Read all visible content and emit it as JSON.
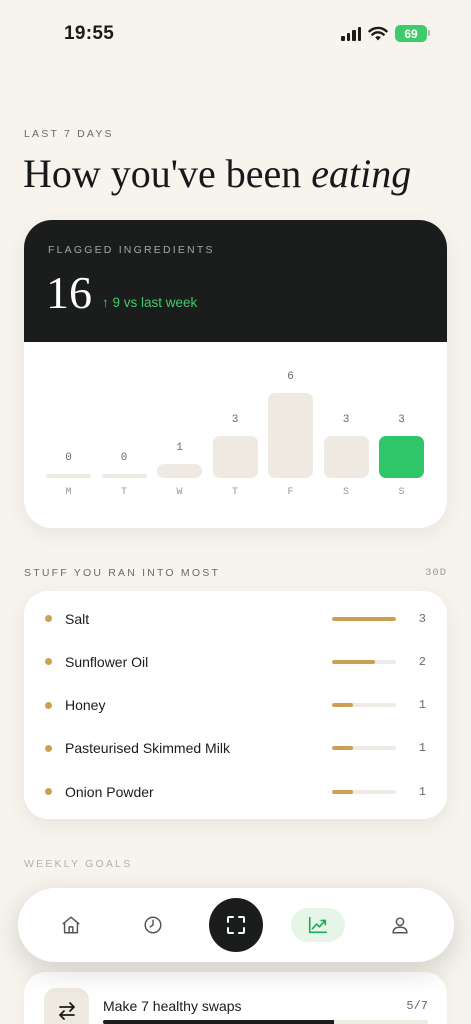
{
  "status": {
    "time": "19:55",
    "battery": "69"
  },
  "header": {
    "eyebrow": "LAST 7 DAYS",
    "title_main": "How you've been",
    "title_em": "eating"
  },
  "flagged": {
    "label": "FLAGGED INGREDIENTS",
    "count": "16",
    "delta": "↑ 9 vs last week",
    "accent": "#2fc66a"
  },
  "chart_data": {
    "type": "bar",
    "categories": [
      "M",
      "T",
      "W",
      "T",
      "F",
      "S",
      "S"
    ],
    "values": [
      0,
      0,
      1,
      3,
      6,
      3,
      3
    ],
    "highlight_index": 6,
    "ylim": [
      0,
      6
    ]
  },
  "stuff": {
    "label": "STUFF YOU RAN INTO MOST",
    "range": "30D",
    "items": [
      {
        "name": "Salt",
        "count": "3",
        "fraction": 1.0
      },
      {
        "name": "Sunflower Oil",
        "count": "2",
        "fraction": 0.67
      },
      {
        "name": "Honey",
        "count": "1",
        "fraction": 0.33
      },
      {
        "name": "Pasteurised Skimmed Milk",
        "count": "1",
        "fraction": 0.33
      },
      {
        "name": "Onion Powder",
        "count": "1",
        "fraction": 0.33
      }
    ]
  },
  "goals": {
    "label": "WEEKLY GOALS",
    "items": [
      {
        "title": "Make 7 healthy swaps",
        "progress": "5/7",
        "fraction": 0.71,
        "icon": "swap-icon"
      }
    ]
  },
  "nav": {
    "items": [
      "home-icon",
      "history-icon",
      "scan-icon",
      "trends-icon",
      "profile-icon"
    ],
    "active": "trends-icon"
  }
}
